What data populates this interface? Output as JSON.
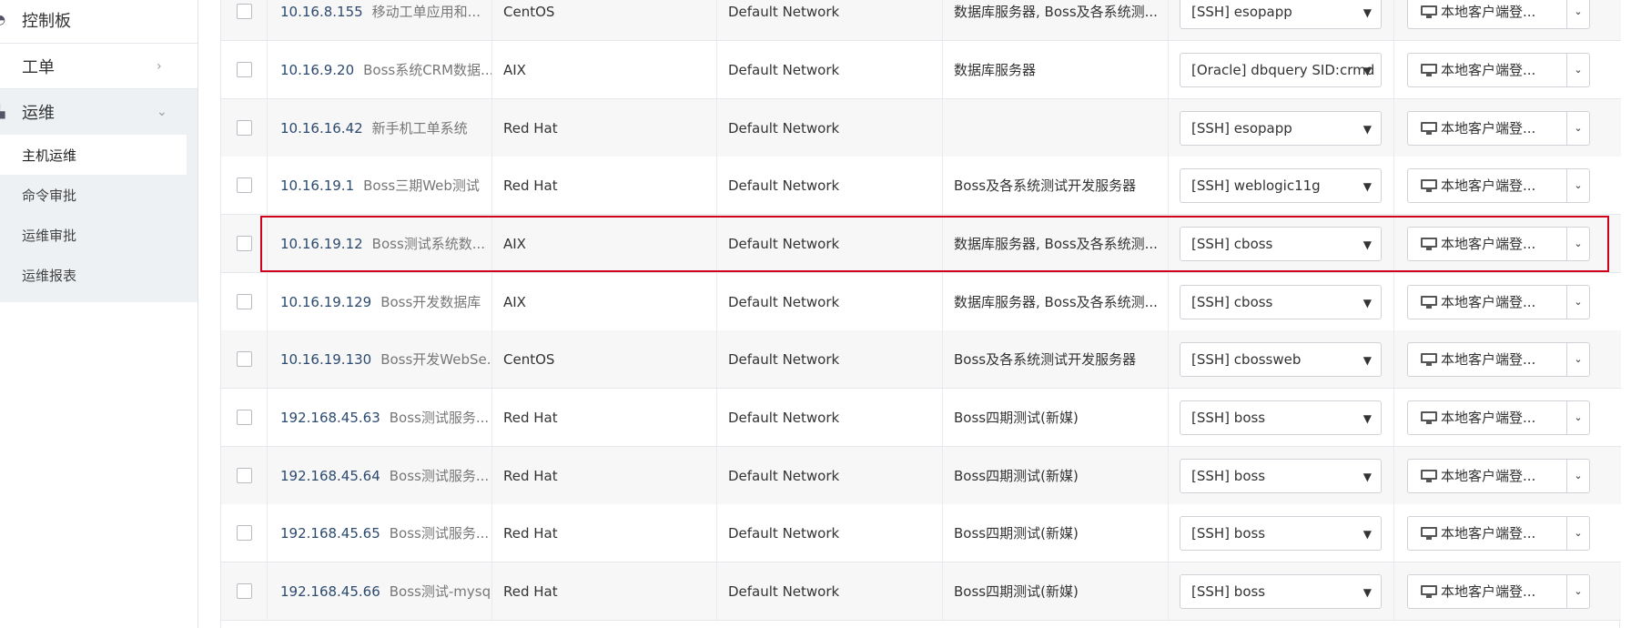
{
  "sidebar": {
    "items": [
      {
        "label": "控制板",
        "icon": "dashboard-icon"
      },
      {
        "label": "工单",
        "icon": "ticket-icon"
      },
      {
        "label": "运维",
        "icon": "sitemap-icon"
      }
    ],
    "sub_items": [
      {
        "label": "主机运维",
        "active": true
      },
      {
        "label": "命令审批"
      },
      {
        "label": "运维审批"
      },
      {
        "label": "运维报表"
      }
    ]
  },
  "action_label": "本地客户端登...",
  "rows": [
    {
      "ip": "10.16.8.155",
      "name": "移动工单应用和...",
      "os": "CentOS",
      "network": "Default Network",
      "group": "数据库服务器, Boss及各系统测...",
      "account": "[SSH] esopapp"
    },
    {
      "ip": "10.16.9.20",
      "name": "Boss系统CRM数据...",
      "os": "AIX",
      "network": "Default Network",
      "group": "数据库服务器",
      "account": "[Oracle] dbquery SID:crmd"
    },
    {
      "ip": "10.16.16.42",
      "name": "新手机工单系统",
      "os": "Red Hat",
      "network": "Default Network",
      "group": "",
      "account": "[SSH] esopapp"
    },
    {
      "ip": "10.16.19.1",
      "name": "Boss三期Web测试",
      "os": "Red Hat",
      "network": "Default Network",
      "group": "Boss及各系统测试开发服务器",
      "account": "[SSH] weblogic11g"
    },
    {
      "ip": "10.16.19.12",
      "name": "Boss测试系统数...",
      "os": "AIX",
      "network": "Default Network",
      "group": "数据库服务器, Boss及各系统测...",
      "account": "[SSH] cboss",
      "highlighted": true
    },
    {
      "ip": "10.16.19.129",
      "name": "Boss开发数据库",
      "os": "AIX",
      "network": "Default Network",
      "group": "数据库服务器, Boss及各系统测...",
      "account": "[SSH] cboss"
    },
    {
      "ip": "10.16.19.130",
      "name": "Boss开发WebSe...",
      "os": "CentOS",
      "network": "Default Network",
      "group": "Boss及各系统测试开发服务器",
      "account": "[SSH] cbossweb"
    },
    {
      "ip": "192.168.45.63",
      "name": "Boss测试服务...",
      "os": "Red Hat",
      "network": "Default Network",
      "group": "Boss四期测试(新媒)",
      "account": "[SSH] boss"
    },
    {
      "ip": "192.168.45.64",
      "name": "Boss测试服务...",
      "os": "Red Hat",
      "network": "Default Network",
      "group": "Boss四期测试(新媒)",
      "account": "[SSH] boss"
    },
    {
      "ip": "192.168.45.65",
      "name": "Boss测试服务...",
      "os": "Red Hat",
      "network": "Default Network",
      "group": "Boss四期测试(新媒)",
      "account": "[SSH] boss"
    },
    {
      "ip": "192.168.45.66",
      "name": "Boss测试-mysq...",
      "os": "Red Hat",
      "network": "Default Network",
      "group": "Boss四期测试(新媒)",
      "account": "[SSH] boss"
    }
  ],
  "colors": {
    "highlight": "#d0021b",
    "ip_text": "#2c4a6e"
  }
}
